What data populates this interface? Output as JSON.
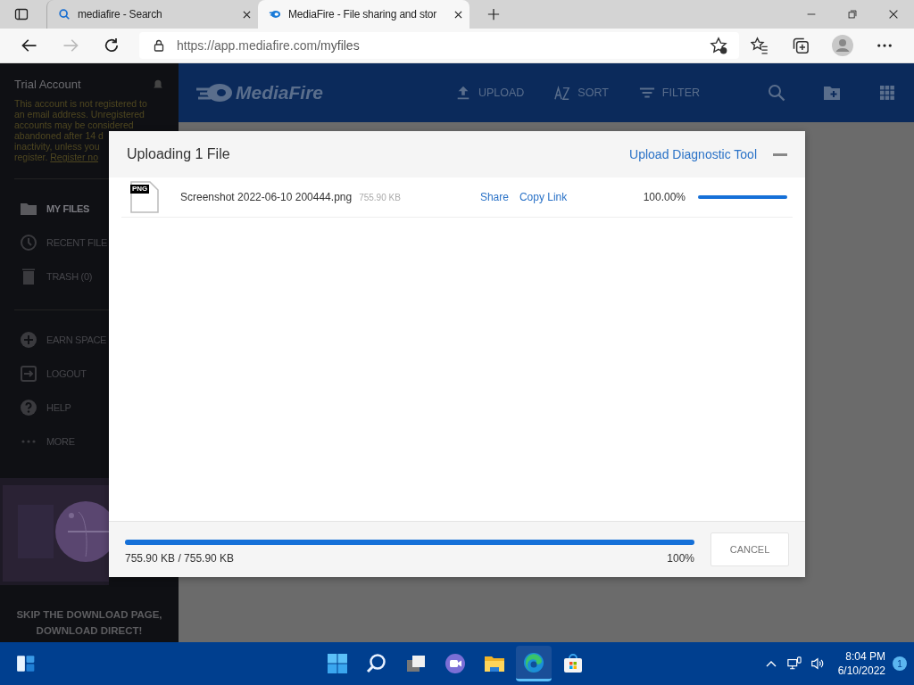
{
  "browser": {
    "tabs": [
      {
        "title": "mediafire - Search",
        "selected": false
      },
      {
        "title": "MediaFire - File sharing and stor",
        "selected": true
      }
    ],
    "url": {
      "host": "https://app.mediafire.com",
      "path": "/myfiles"
    }
  },
  "sidebar": {
    "account_title": "Trial Account",
    "notice_lines": [
      "This account is not registered to",
      "an email address. Unregistered",
      "accounts may be considered",
      "abandoned after 14 d",
      "inactivity, unless you"
    ],
    "notice_last": "register.",
    "register_link": "Register no",
    "items": [
      {
        "kind": "folder",
        "label": "MY FILES",
        "selected": true
      },
      {
        "kind": "clock",
        "label": "RECENT FILE",
        "selected": false
      },
      {
        "kind": "trash",
        "label": "TRASH (0)",
        "selected": false
      },
      {
        "kind": "plus",
        "label": "EARN SPACE",
        "selected": false
      },
      {
        "kind": "logout",
        "label": "LOGOUT",
        "selected": false
      },
      {
        "kind": "help",
        "label": "HELP",
        "selected": false
      },
      {
        "kind": "more",
        "label": "MORE",
        "selected": false
      }
    ],
    "promo_title": "SKIP THE DOWNLOAD PAGE, DOWNLOAD DIRECT!"
  },
  "header": {
    "logo": "MediaFire",
    "tools": [
      {
        "kind": "upload",
        "label": "UPLOAD"
      },
      {
        "kind": "sort",
        "label": "SORT"
      },
      {
        "kind": "filter",
        "label": "FILTER"
      }
    ]
  },
  "upload_dialog": {
    "title": "Uploading 1 File",
    "diagnostic_link": "Upload Diagnostic Tool",
    "files": [
      {
        "type_badge": "PNG",
        "name": "Screenshot 2022-06-10 200444.png",
        "size": "755.90 KB",
        "actions": [
          "Share",
          "Copy Link"
        ],
        "percent": "100.00%",
        "level": 1
      }
    ],
    "total": {
      "level": 1,
      "transferred": "755.90 KB / 755.90 KB",
      "percent": "100%"
    },
    "cancel_button": "CANCEL"
  },
  "taskbar": {
    "apps": [
      {
        "kind": "start",
        "selected": false
      },
      {
        "kind": "search",
        "selected": false
      },
      {
        "kind": "taskview",
        "selected": false
      },
      {
        "kind": "chat",
        "selected": false
      },
      {
        "kind": "explorer",
        "selected": false
      },
      {
        "kind": "edge",
        "selected": true
      },
      {
        "kind": "store",
        "selected": false
      }
    ],
    "time": "8:04 PM",
    "date": "6/10/2022",
    "notifications": "1"
  }
}
